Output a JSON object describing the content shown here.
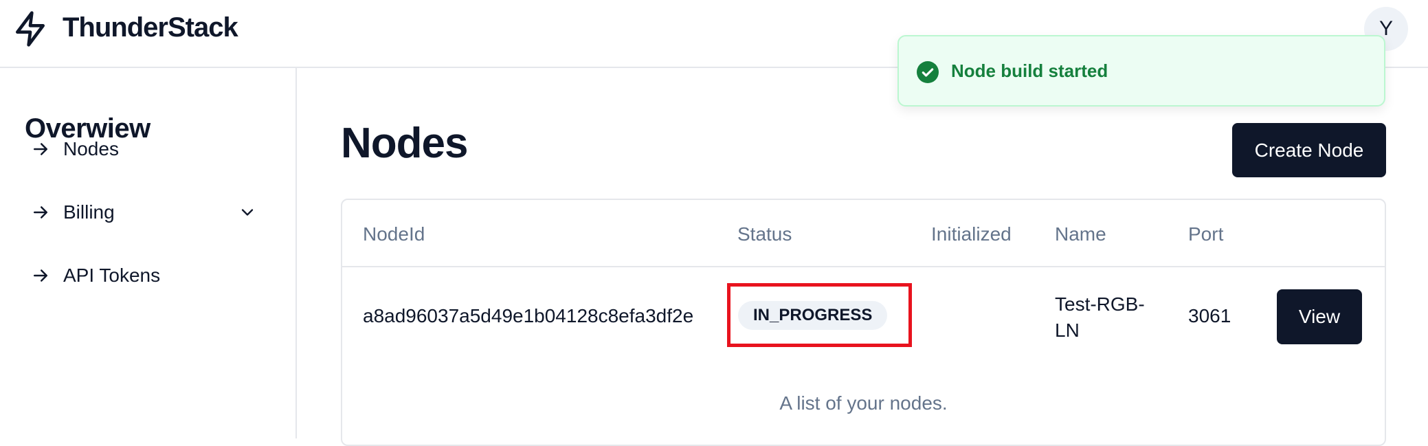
{
  "app": {
    "brand": "ThunderStack",
    "avatar_initial": "Y"
  },
  "sidebar": {
    "title": "Overwiew",
    "items": [
      {
        "label": "Nodes",
        "icon": "arrow-right-icon"
      },
      {
        "label": "Billing",
        "icon": "arrow-right-icon",
        "expandable": true
      },
      {
        "label": "API Tokens",
        "icon": "arrow-right-icon"
      }
    ]
  },
  "main": {
    "title": "Nodes",
    "create_button": "Create Node",
    "table": {
      "headers": [
        "NodeId",
        "Status",
        "Initialized",
        "Name",
        "Port"
      ],
      "rows": [
        {
          "node_id": "a8ad96037a5d49e1b04128c8efa3df2e",
          "status": "IN_PROGRESS",
          "initialized": "",
          "name": "Test-RGB-LN",
          "port": "3061",
          "action": "View"
        }
      ],
      "caption": "A list of your nodes."
    }
  },
  "toast": {
    "message": "Node build started",
    "type": "success"
  },
  "colors": {
    "primary": "#0f172a",
    "muted_text": "#64748b",
    "badge_bg": "#eef2f7",
    "success_bg": "#ecfdf3",
    "success_text": "#15803d",
    "highlight": "#e8131e"
  }
}
